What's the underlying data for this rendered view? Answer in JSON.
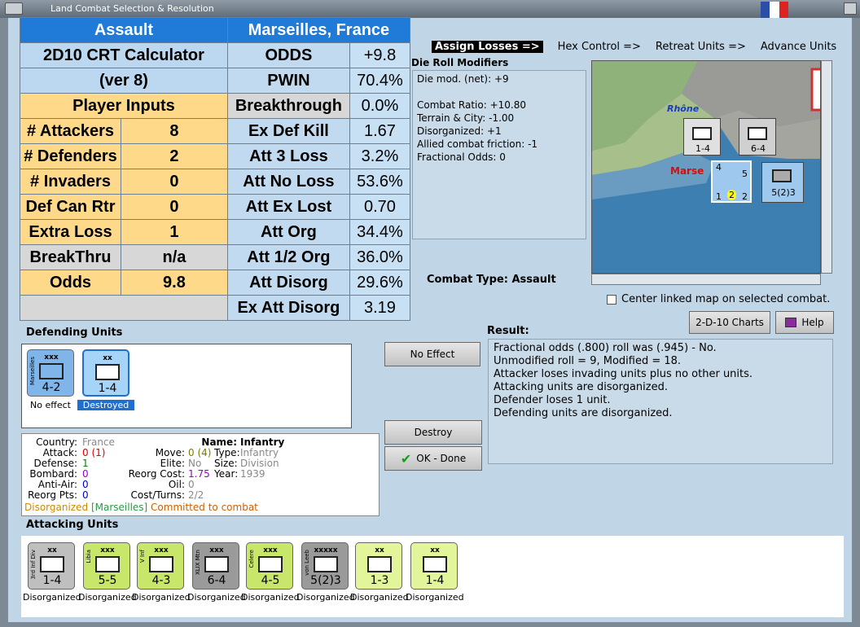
{
  "window": {
    "title": "Land Combat Selection & Resolution"
  },
  "calc": {
    "assault": "Assault",
    "location": "Marseilles, France",
    "title1": "2D10 CRT Calculator",
    "title2": "(ver 8)",
    "player_inputs": "Player Inputs",
    "rows_left": [
      {
        "label": "# Attackers",
        "value": "8"
      },
      {
        "label": "# Defenders",
        "value": "2"
      },
      {
        "label": "# Invaders",
        "value": "0"
      },
      {
        "label": "Def Can Rtr",
        "value": "0"
      },
      {
        "label": "Extra Loss",
        "value": "1"
      },
      {
        "label": "BreakThru",
        "value": "n/a"
      },
      {
        "label": "Odds",
        "value": "9.8"
      }
    ],
    "rows_right": [
      {
        "label": "ODDS",
        "value": "+9.8"
      },
      {
        "label": "PWIN",
        "value": "70.4%"
      },
      {
        "label": "Breakthrough",
        "value": "0.0%"
      },
      {
        "label": "Ex Def Kill",
        "value": "1.67"
      },
      {
        "label": "Att 3 Loss",
        "value": "3.2%"
      },
      {
        "label": "Att No Loss",
        "value": "53.6%"
      },
      {
        "label": "Att Ex Lost",
        "value": "0.70"
      },
      {
        "label": "Att Org",
        "value": "34.4%"
      },
      {
        "label": "Att 1/2 Org",
        "value": "36.0%"
      },
      {
        "label": "Att Disorg",
        "value": "29.6%"
      },
      {
        "label": "Ex Att Disorg",
        "value": "3.19"
      }
    ]
  },
  "tabs": [
    "Assign Losses =>",
    "Hex Control =>",
    "Retreat Units =>",
    "Advance Units"
  ],
  "drm": {
    "title": "Die Roll Modifiers",
    "lines": [
      "Die mod. (net): +9",
      "",
      "Combat Ratio: +10.80",
      "Terrain & City: -1.00",
      "Disorganized: +1",
      "Allied combat friction: -1",
      "Fractional Odds: 0"
    ]
  },
  "combat_type": "Combat Type:  Assault",
  "map": {
    "city": "Marse",
    "river": "Rhône",
    "units": [
      "1-4",
      "6-4",
      "5(2)3"
    ],
    "stack_top": "4",
    "stack_vals": [
      "1",
      "2",
      "2"
    ],
    "stack_str": "5"
  },
  "center_link": "Center linked map on selected combat.",
  "buttons": {
    "charts": "2-D-10 Charts",
    "help": "Help",
    "no_effect": "No Effect",
    "destroy": "Destroy",
    "ok": "OK - Done"
  },
  "defending": {
    "title": "Defending Units",
    "units": [
      {
        "size": "xxx",
        "name": "Marseilles",
        "str": "4-2",
        "status": "No effect"
      },
      {
        "size": "xx",
        "name": "",
        "str": "1-4",
        "status": "Destroyed"
      }
    ]
  },
  "result": {
    "title": "Result:",
    "lines": [
      "Fractional odds (.800) roll was (.945)  - No.",
      "Unmodified roll = 9, Modified = 18.",
      "Attacker loses invading units plus no other units.",
      "Attacking units are disorganized.",
      "Defender loses 1 unit.",
      "Defending units are disorganized."
    ]
  },
  "info": {
    "country_l": "Country:",
    "country_v": "France",
    "attack_l": "Attack:",
    "attack_v": "0 (1)",
    "defense_l": "Defense:",
    "defense_v": "1",
    "bombard_l": "Bombard:",
    "bombard_v": "0",
    "antiair_l": "Anti-Air:",
    "antiair_v": "0",
    "reorg_l": "Reorg Pts:",
    "reorg_v": "0",
    "name_l": "Name:",
    "name_v": "Infantry",
    "move_l": "Move:",
    "move_v": "0 (4)",
    "type_l": "Type:",
    "type_v": "Infantry",
    "elite_l": "Elite:",
    "elite_v": "No",
    "size_l": "Size:",
    "size_v": "Division",
    "reorgcost_l": "Reorg Cost:",
    "reorgcost_v": "1.75",
    "year_l": "Year:",
    "year_v": "1939",
    "oil_l": "Oil:",
    "oil_v": "0",
    "cost_l": "Cost/Turns:",
    "cost_v": "2/2",
    "status1": "Disorganized",
    "status2": "[Marseilles]",
    "status3": "Committed to combat"
  },
  "attacking": {
    "title": "Attacking Units",
    "units": [
      {
        "size": "xx",
        "name": "3rd Inf Div",
        "str": "1-4",
        "status": "Disorganized",
        "color": "#bfbfbf"
      },
      {
        "size": "xxx",
        "name": "Libia",
        "str": "5-5",
        "status": "Disorganized",
        "color": "#c8e66a"
      },
      {
        "size": "xxx",
        "name": "V Inf",
        "str": "4-3",
        "status": "Disorganized",
        "color": "#c8e66a"
      },
      {
        "size": "xxx",
        "name": "XLIX Mtn",
        "str": "6-4",
        "status": "Disorganized",
        "color": "#9a9a9a"
      },
      {
        "size": "xxx",
        "name": "Celere",
        "str": "4-5",
        "status": "Disorganized",
        "color": "#c8e66a"
      },
      {
        "size": "xxxxx",
        "name": "von Leeb",
        "str": "5(2)3",
        "status": "Disorganized",
        "color": "#9a9a9a"
      },
      {
        "size": "xx",
        "name": "",
        "str": "1-3",
        "status": "Disorganized",
        "color": "#e2f59a"
      },
      {
        "size": "xx",
        "name": "",
        "str": "1-4",
        "status": "Disorganized",
        "color": "#e2f59a"
      }
    ]
  }
}
